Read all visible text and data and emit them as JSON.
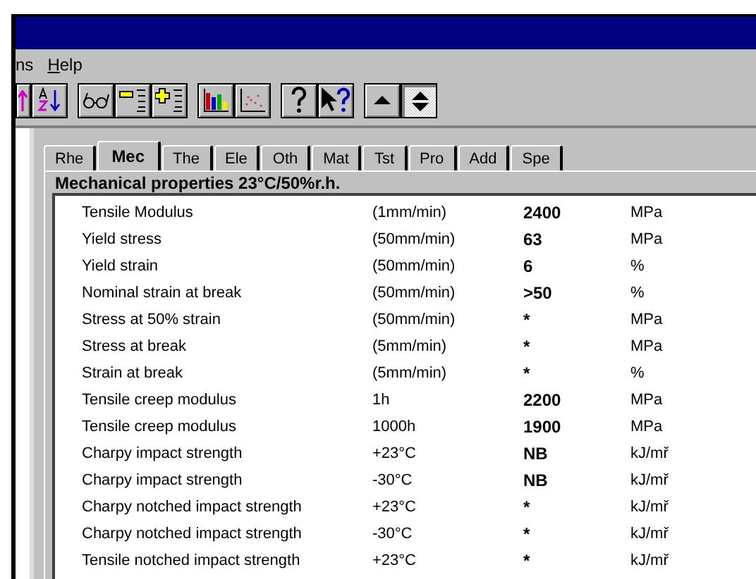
{
  "menu": [
    {
      "label": "ns",
      "mnemonic": false
    },
    {
      "label": "Help",
      "mnemonic": true
    }
  ],
  "toolbar": [
    {
      "kind": "sort-up",
      "pressed": false
    },
    {
      "kind": "sort-az",
      "pressed": false
    },
    {
      "kind": "glasses",
      "pressed": false
    },
    {
      "kind": "list-minus",
      "pressed": false
    },
    {
      "kind": "list-plus",
      "pressed": false
    },
    {
      "kind": "bar-chart",
      "pressed": false
    },
    {
      "kind": "scatter",
      "pressed": false
    },
    {
      "kind": "help",
      "pressed": false
    },
    {
      "kind": "pointer-help",
      "pressed": false
    },
    {
      "kind": "up",
      "pressed": false
    },
    {
      "kind": "up-down",
      "pressed": true
    }
  ],
  "tabs": [
    {
      "label": "Rhe",
      "selected": false
    },
    {
      "label": "Mec",
      "selected": true
    },
    {
      "label": "The",
      "selected": false
    },
    {
      "label": "Ele",
      "selected": false
    },
    {
      "label": "Oth",
      "selected": false
    },
    {
      "label": "Mat",
      "selected": false
    },
    {
      "label": "Tst",
      "selected": false
    },
    {
      "label": "Pro",
      "selected": false
    },
    {
      "label": "Add",
      "selected": false
    },
    {
      "label": "Spe",
      "selected": false
    }
  ],
  "section_title": "Mechanical properties 23°C/50%r.h.",
  "rows": [
    {
      "property": "Tensile Modulus",
      "condition": "(1mm/min)",
      "value": "2400",
      "unit": "MPa"
    },
    {
      "property": "Yield stress",
      "condition": "(50mm/min)",
      "value": "63",
      "unit": "MPa"
    },
    {
      "property": "Yield strain",
      "condition": "(50mm/min)",
      "value": "6",
      "unit": "%"
    },
    {
      "property": "Nominal strain at break",
      "condition": "(50mm/min)",
      "value": ">50",
      "unit": "%"
    },
    {
      "property": "Stress at 50% strain",
      "condition": "(50mm/min)",
      "value": "*",
      "unit": "MPa"
    },
    {
      "property": "Stress at break",
      "condition": "(5mm/min)",
      "value": "*",
      "unit": "MPa"
    },
    {
      "property": "Strain at break",
      "condition": "(5mm/min)",
      "value": "*",
      "unit": "%"
    },
    {
      "property": "Tensile creep modulus",
      "condition": "1h",
      "value": "2200",
      "unit": "MPa"
    },
    {
      "property": "Tensile creep modulus",
      "condition": "1000h",
      "value": "1900",
      "unit": "MPa"
    },
    {
      "property": "Charpy impact strength",
      "condition": "+23°C",
      "value": "NB",
      "unit": "kJ/mř"
    },
    {
      "property": "Charpy impact strength",
      "condition": "-30°C",
      "value": "NB",
      "unit": "kJ/mř"
    },
    {
      "property": "Charpy notched impact strength",
      "condition": "+23°C",
      "value": "*",
      "unit": "kJ/mř"
    },
    {
      "property": "Charpy notched impact strength",
      "condition": "-30°C",
      "value": "*",
      "unit": "kJ/mř"
    },
    {
      "property": "Tensile notched impact strength",
      "condition": "+23°C",
      "value": "*",
      "unit": "kJ/mř"
    }
  ]
}
